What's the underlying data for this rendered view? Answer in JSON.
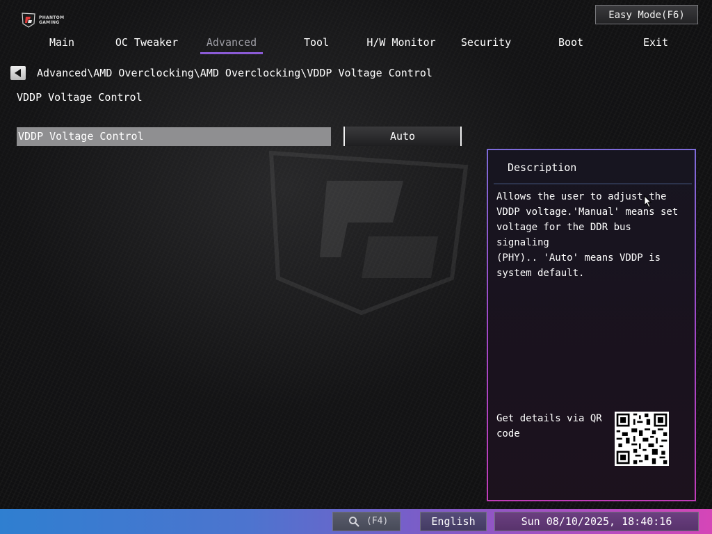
{
  "brand": {
    "logo_line1": "PHANTOM",
    "logo_line2": "GAMING"
  },
  "header": {
    "easy_mode_label": "Easy Mode(F6)"
  },
  "nav": {
    "tabs": [
      {
        "label": "Main"
      },
      {
        "label": "OC Tweaker"
      },
      {
        "label": "Advanced",
        "active": true
      },
      {
        "label": "Tool"
      },
      {
        "label": "H/W Monitor"
      },
      {
        "label": "Security"
      },
      {
        "label": "Boot"
      },
      {
        "label": "Exit"
      }
    ]
  },
  "breadcrumb": "Advanced\\AMD Overclocking\\AMD Overclocking\\VDDP Voltage Control",
  "page_title": "VDDP Voltage Control",
  "settings": [
    {
      "label": "VDDP Voltage Control",
      "value": "Auto"
    }
  ],
  "description": {
    "title": "Description",
    "text": "Allows the user to adjust the\nVDDP voltage.'Manual' means set\nvoltage for the DDR bus signaling\n(PHY).. 'Auto' means VDDP is\nsystem default.",
    "qr_label": "Get details via QR\ncode"
  },
  "footer": {
    "search_key": "(F4)",
    "language": "English",
    "datetime": "Sun 08/10/2025, 18:40:16"
  },
  "colors": {
    "accent_tab": "#8b5bd6",
    "panel_border_top": "#7d6bd8",
    "panel_border_bottom": "#c13cb9",
    "bottom_bar_left": "#2f7fd0",
    "bottom_bar_right": "#d546b7"
  }
}
